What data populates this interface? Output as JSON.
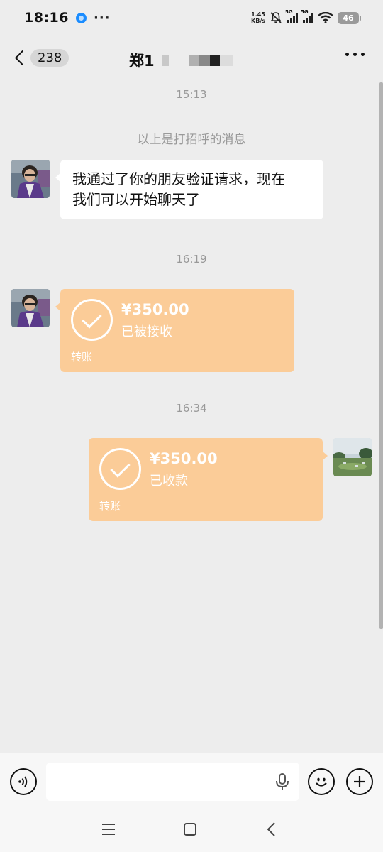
{
  "status_bar": {
    "time": "18:16",
    "dots": "···",
    "net_speed_value": "1.45",
    "net_speed_unit": "KB/s",
    "signal1_label": "5G",
    "signal2_label": "5G",
    "battery": "46"
  },
  "header": {
    "unread_count": "238",
    "title_visible": "郑1"
  },
  "messages": {
    "time1": "15:13",
    "system_text": "以上是打招呼的消息",
    "text_msg_line1": "我通过了你的朋友验证请求，现在",
    "text_msg_line2": "我们可以开始聊天了",
    "time2": "16:19",
    "transfer1": {
      "amount": "¥350.00",
      "status": "已被接收",
      "label": "转账"
    },
    "time3": "16:34",
    "transfer2": {
      "amount": "¥350.00",
      "status": "已收款",
      "label": "转账"
    }
  },
  "input": {
    "value": "",
    "placeholder": ""
  },
  "colors": {
    "transfer_bg": "#fbcc98",
    "chat_bg": "#ededed"
  }
}
